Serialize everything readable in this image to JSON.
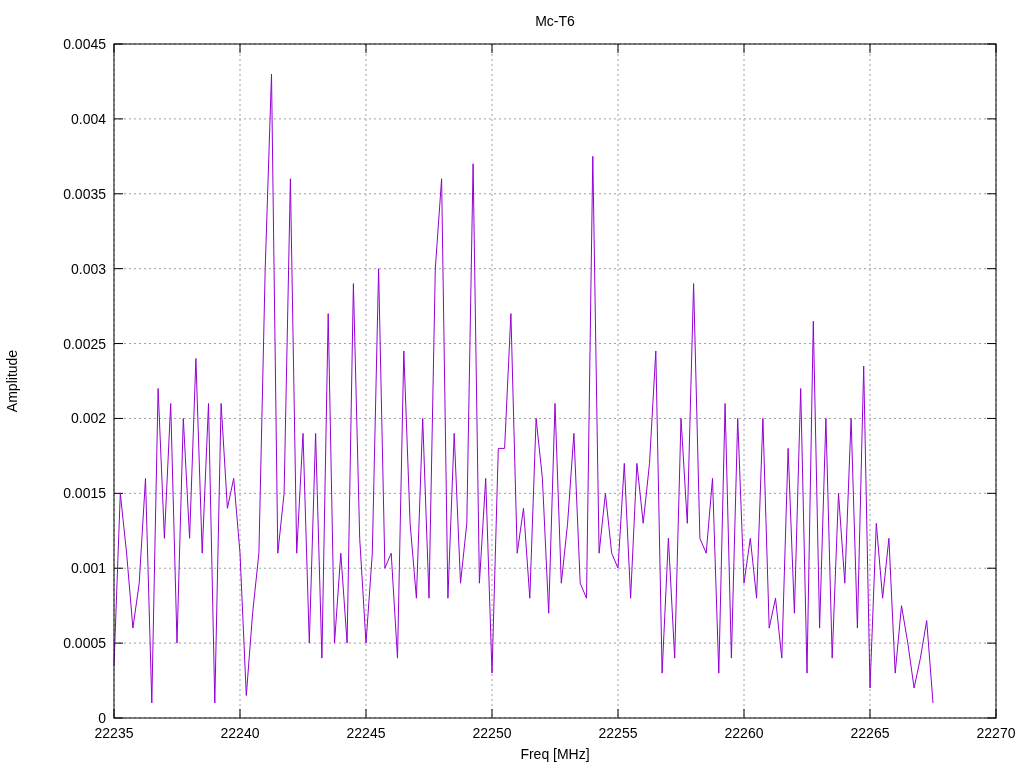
{
  "chart": {
    "chart_data": {
      "type": "line",
      "title": "Mc-T6",
      "xlabel": "Freq [MHz]",
      "ylabel": "Amplitude",
      "grid": true,
      "xlim": [
        22235,
        22270
      ],
      "ylim": [
        0,
        0.0045
      ],
      "xticks": [
        22235,
        22240,
        22245,
        22250,
        22255,
        22260,
        22265,
        22270
      ],
      "yticks": [
        0,
        0.0005,
        0.001,
        0.0015,
        0.002,
        0.0025,
        0.003,
        0.0035,
        0.004,
        0.0045
      ],
      "x": [
        22235,
        22235.25,
        22235.5,
        22235.75,
        22236,
        22236.25,
        22236.5,
        22236.75,
        22237,
        22237.25,
        22237.5,
        22237.75,
        22238,
        22238.25,
        22238.5,
        22238.75,
        22239,
        22239.25,
        22239.5,
        22239.75,
        22240,
        22240.25,
        22240.5,
        22240.75,
        22241,
        22241.25,
        22241.5,
        22241.75,
        22242,
        22242.25,
        22242.5,
        22242.75,
        22243,
        22243.25,
        22243.5,
        22243.75,
        22244,
        22244.25,
        22244.5,
        22244.75,
        22245,
        22245.25,
        22245.5,
        22245.75,
        22246,
        22246.25,
        22246.5,
        22246.75,
        22247,
        22247.25,
        22247.5,
        22247.75,
        22248,
        22248.25,
        22248.5,
        22248.75,
        22249,
        22249.25,
        22249.5,
        22249.75,
        22250,
        22250.25,
        22250.5,
        22250.75,
        22251,
        22251.25,
        22251.5,
        22251.75,
        22252,
        22252.25,
        22252.5,
        22252.75,
        22253,
        22253.25,
        22253.5,
        22253.75,
        22254,
        22254.25,
        22254.5,
        22254.75,
        22255,
        22255.25,
        22255.5,
        22255.75,
        22256,
        22256.25,
        22256.5,
        22256.75,
        22257,
        22257.25,
        22257.5,
        22257.75,
        22258,
        22258.25,
        22258.5,
        22258.75,
        22259,
        22259.25,
        22259.5,
        22259.75,
        22260,
        22260.25,
        22260.5,
        22260.75,
        22261,
        22261.25,
        22261.5,
        22261.75,
        22262,
        22262.25,
        22262.5,
        22262.75,
        22263,
        22263.25,
        22263.5,
        22263.75,
        22264,
        22264.25,
        22264.5,
        22264.75,
        22265,
        22265.25,
        22265.5,
        22265.75,
        22266,
        22266.25,
        22266.5,
        22266.75,
        22267,
        22267.25,
        22267.5
      ],
      "series": [
        {
          "color": "#9400d3",
          "values": [
            0.00035,
            0.0015,
            0.0011,
            0.0006,
            0.0009,
            0.0016,
            0.0001,
            0.0022,
            0.0012,
            0.0021,
            0.0005,
            0.002,
            0.0012,
            0.0024,
            0.0011,
            0.0021,
            0.0001,
            0.0021,
            0.0014,
            0.0016,
            0.0011,
            0.00015,
            0.0007,
            0.0011,
            0.003,
            0.0043,
            0.0011,
            0.0015,
            0.0036,
            0.0011,
            0.0019,
            0.0005,
            0.0019,
            0.0004,
            0.0027,
            0.0005,
            0.0011,
            0.0005,
            0.0029,
            0.0012,
            0.0005,
            0.0011,
            0.003,
            0.001,
            0.0011,
            0.0004,
            0.00245,
            0.0013,
            0.0008,
            0.002,
            0.0008,
            0.003,
            0.0036,
            0.0008,
            0.0019,
            0.0009,
            0.0013,
            0.0037,
            0.0009,
            0.0016,
            0.0003,
            0.0018,
            0.0018,
            0.0027,
            0.0011,
            0.0014,
            0.0008,
            0.002,
            0.0016,
            0.0007,
            0.0021,
            0.0009,
            0.0013,
            0.0019,
            0.0009,
            0.0008,
            0.00375,
            0.0011,
            0.0015,
            0.0011,
            0.001,
            0.0017,
            0.0008,
            0.0017,
            0.0013,
            0.0017,
            0.00245,
            0.0003,
            0.0012,
            0.0004,
            0.002,
            0.0013,
            0.0029,
            0.0012,
            0.0011,
            0.0016,
            0.0003,
            0.0021,
            0.0004,
            0.002,
            0.0009,
            0.0012,
            0.0008,
            0.002,
            0.0006,
            0.0008,
            0.0004,
            0.0018,
            0.0007,
            0.0022,
            0.0003,
            0.00265,
            0.0006,
            0.002,
            0.0004,
            0.0015,
            0.0009,
            0.002,
            0.0006,
            0.00235,
            0.0002,
            0.0013,
            0.0008,
            0.0012,
            0.0003,
            0.00075,
            0.0005,
            0.0002,
            0.0004,
            0.00065,
            0.0001
          ]
        }
      ]
    }
  }
}
